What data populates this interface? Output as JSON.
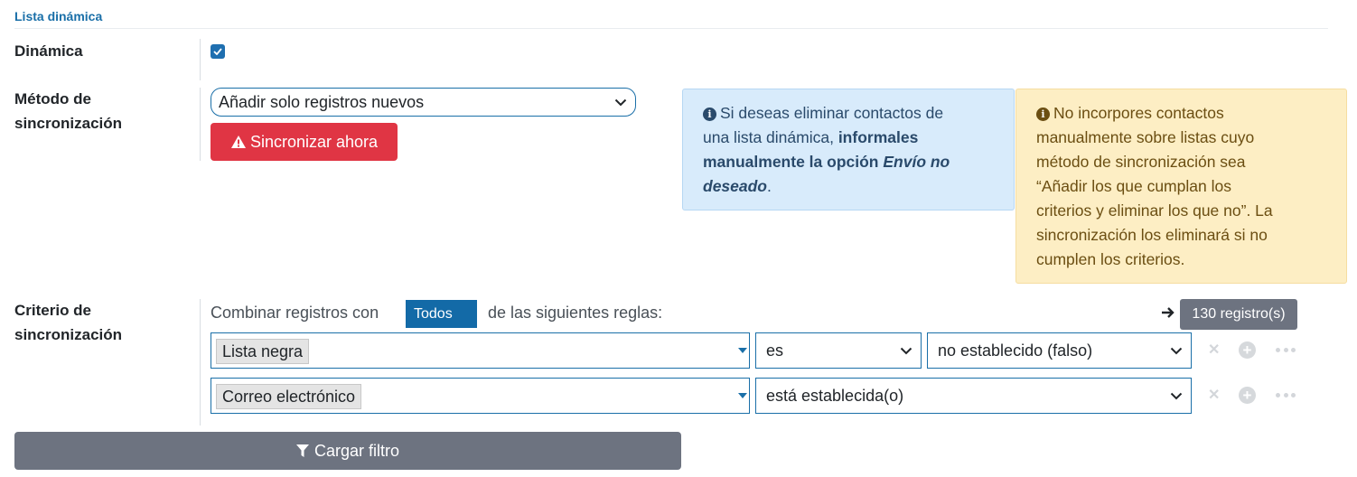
{
  "section": {
    "title": "Lista dinámica"
  },
  "dynamic": {
    "label": "Dinámica",
    "checked": true
  },
  "sync_method": {
    "label_line1": "Método de",
    "label_line2": "sincronización",
    "selected": "Añadir solo registros nuevos",
    "sync_button": "Sincronizar ahora"
  },
  "info_alert": {
    "line1": "Si deseas eliminar contactos de",
    "line2_a": "una lista dinámica, ",
    "line2_b": "informales",
    "line3_a": "manualmente la opción ",
    "line3_b": "Envío no",
    "line4_a": "deseado",
    "line4_b": "."
  },
  "warning_alert": {
    "line1": "No incorpores contactos",
    "line2": "manualmente sobre listas cuyo",
    "line3": "método de sincronización sea",
    "line4": "“Añadir los que cumplan los",
    "line5": "criterios y eliminar los que no”. La",
    "line6": "sincronización los eliminará si no",
    "line7": "cumplen los criterios."
  },
  "criteria": {
    "label_line1": "Criterio de",
    "label_line2": "sincronización",
    "combine_prefix": "Combinar registros con",
    "combine_value": "Todos",
    "combine_suffix": "de las siguientes reglas:",
    "record_count": "130 registro(s)",
    "rules": [
      {
        "field": "Lista negra",
        "operator": "es",
        "value": "no establecido (falso)"
      },
      {
        "field": "Correo electrónico",
        "operator": "está establecida(o)"
      }
    ],
    "load_filter_button": "Cargar filtro"
  },
  "icons": {
    "check": "check-icon",
    "warning": "exclamation-triangle-icon",
    "info": "info-circle-icon",
    "arrow": "arrow-right-icon",
    "remove": "times-icon",
    "add": "plus-circle-icon",
    "more": "ellipsis-icon",
    "filter": "filter-icon"
  },
  "colors": {
    "primary": "#1a6fa8",
    "danger": "#e03544",
    "secondary": "#6d7380",
    "info_bg": "#d8ebfb",
    "warning_bg": "#fdeec4"
  }
}
